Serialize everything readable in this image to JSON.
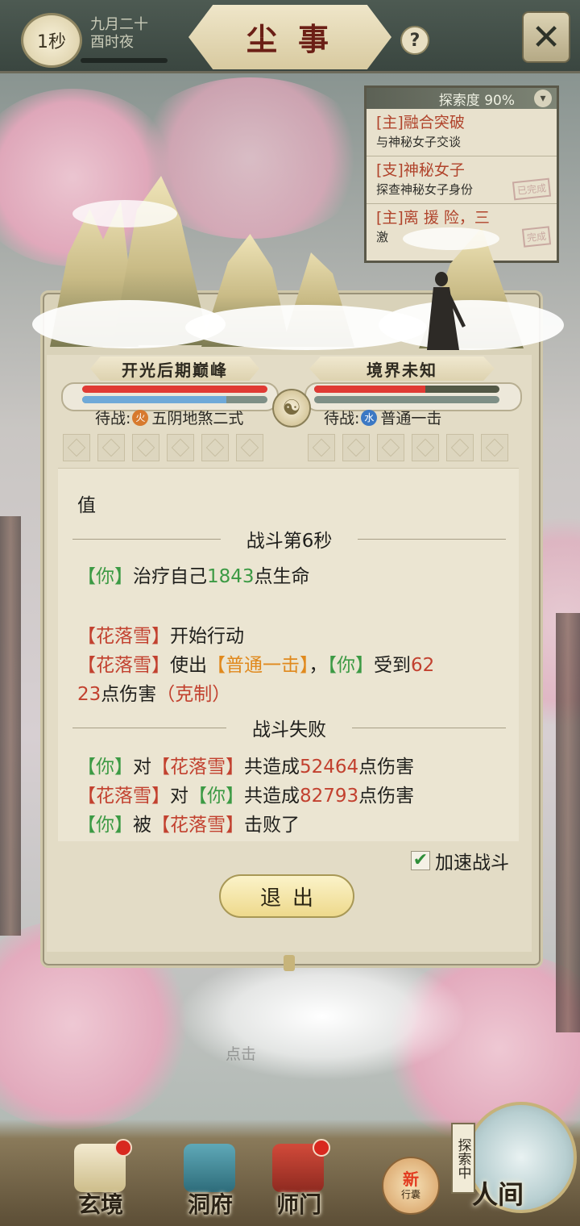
{
  "header": {
    "timer": "1秒",
    "date_line1": "九月二十",
    "date_line2": "酉时夜",
    "title": "尘事",
    "help": "?",
    "close_icon": "✕"
  },
  "quest_panel": {
    "exploration": "探索度 90%",
    "toggle_icon": "chevron-down-icon",
    "items": [
      {
        "title": "[主]融合突破",
        "desc": "与神秘女子交谈",
        "stamp": ""
      },
      {
        "title": "[支]神秘女子",
        "desc": "探查神秘女子身份",
        "stamp": "已完成"
      },
      {
        "title": "[主]离 援 险，三",
        "desc": "激",
        "stamp": "完成"
      }
    ]
  },
  "battle": {
    "player_realm": "开光后期巅峰",
    "enemy_realm": "境界未知",
    "player_hp_fraction": 1.0,
    "player_mp_fraction": 0.78,
    "enemy_hp_fraction": 0.6,
    "enemy_mp_fraction": 1.0,
    "player_pending_label": "待战:",
    "player_pending_element": "火",
    "player_pending_skill": "五阴地煞二式",
    "enemy_pending_label": "待战:",
    "enemy_pending_element": "水",
    "enemy_pending_skill": "普通一击",
    "colors": {
      "hp": "#e03a34",
      "mp": "#6fa9d8",
      "you": "#3c9a44",
      "enemy": "#c2412f",
      "skill": "#e0891d"
    }
  },
  "log": {
    "top_fragment": "值",
    "section1": "战斗第6秒",
    "you": "【你】",
    "heal_text": "治疗自己",
    "heal_value": "1843",
    "heal_suffix": "点生命",
    "enemy": "【花落雪】",
    "start_action": "开始行动",
    "use_text": "使出",
    "skill": "【普通一击】",
    "comma": "，",
    "receive_text": "受到",
    "damage_part1": "62",
    "damage_part2": "23",
    "damage_suffix": "点伤害",
    "restraint": "（克制）",
    "section2": "战斗失败",
    "to": "对",
    "total_dealt": "共造成",
    "you_dealt": "52464",
    "enemy_dealt": "82793",
    "by": "被",
    "defeated": "击败了"
  },
  "controls": {
    "speed_label": "加速战斗",
    "speed_checked": true,
    "exit_label": "退出"
  },
  "faint_text": "点击",
  "nav": {
    "items": [
      {
        "label": "玄境"
      },
      {
        "label": "洞府"
      },
      {
        "label": "师门"
      }
    ],
    "bag_new": "新",
    "bag_label": "行囊",
    "world_tag": "探索中",
    "world_label": "人间"
  }
}
